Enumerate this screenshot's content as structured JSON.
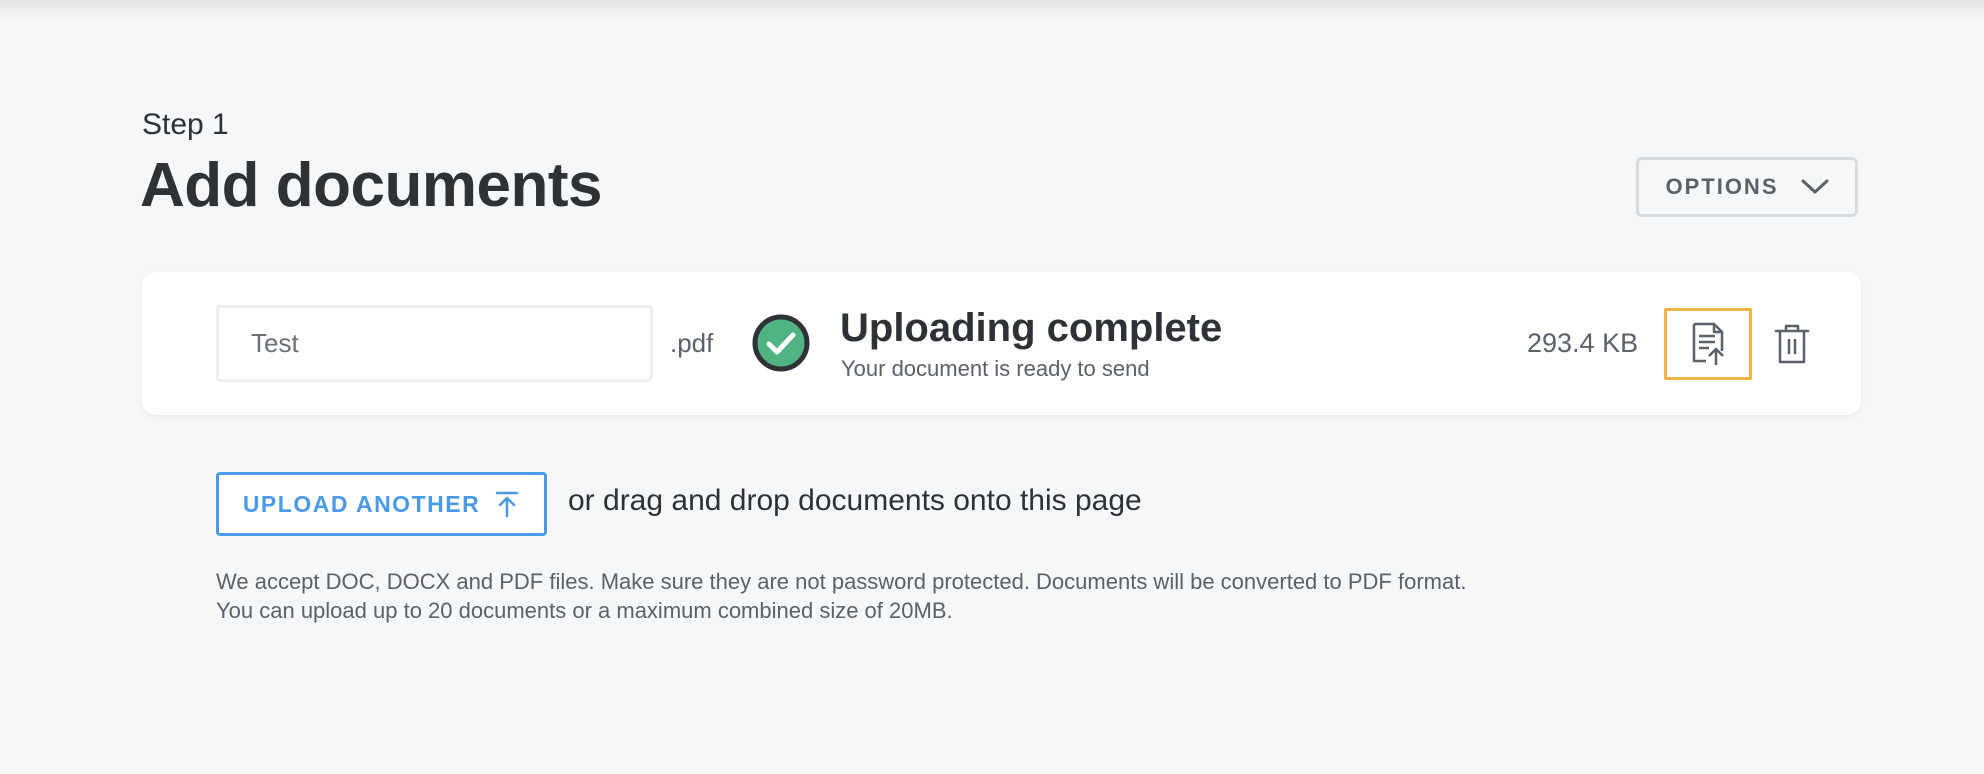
{
  "header": {
    "step": "Step 1",
    "title": "Add documents",
    "options_label": "OPTIONS"
  },
  "document": {
    "name_value": "Test",
    "extension": ".pdf",
    "status_title": "Uploading complete",
    "status_subtitle": "Your document is ready to send",
    "file_size": "293.4 KB"
  },
  "upload": {
    "button_label": "UPLOAD ANOTHER",
    "drag_text": "or drag and drop documents onto this page"
  },
  "help": {
    "line1": "We accept DOC, DOCX and PDF files. Make sure they are not password protected. Documents will be converted to PDF format.",
    "line2": "You can upload up to 20 documents or a maximum combined size of 20MB."
  },
  "colors": {
    "accent_blue": "#4b9ae8",
    "success_green": "#4fb382",
    "focus_orange": "#f3b24a",
    "text_dark": "#2e3236",
    "text_muted": "#5b6169"
  },
  "icons": {
    "options": "chevron-down-icon",
    "status": "check-circle-icon",
    "replace": "document-upload-icon",
    "delete": "trash-icon",
    "upload": "upload-arrow-icon"
  }
}
